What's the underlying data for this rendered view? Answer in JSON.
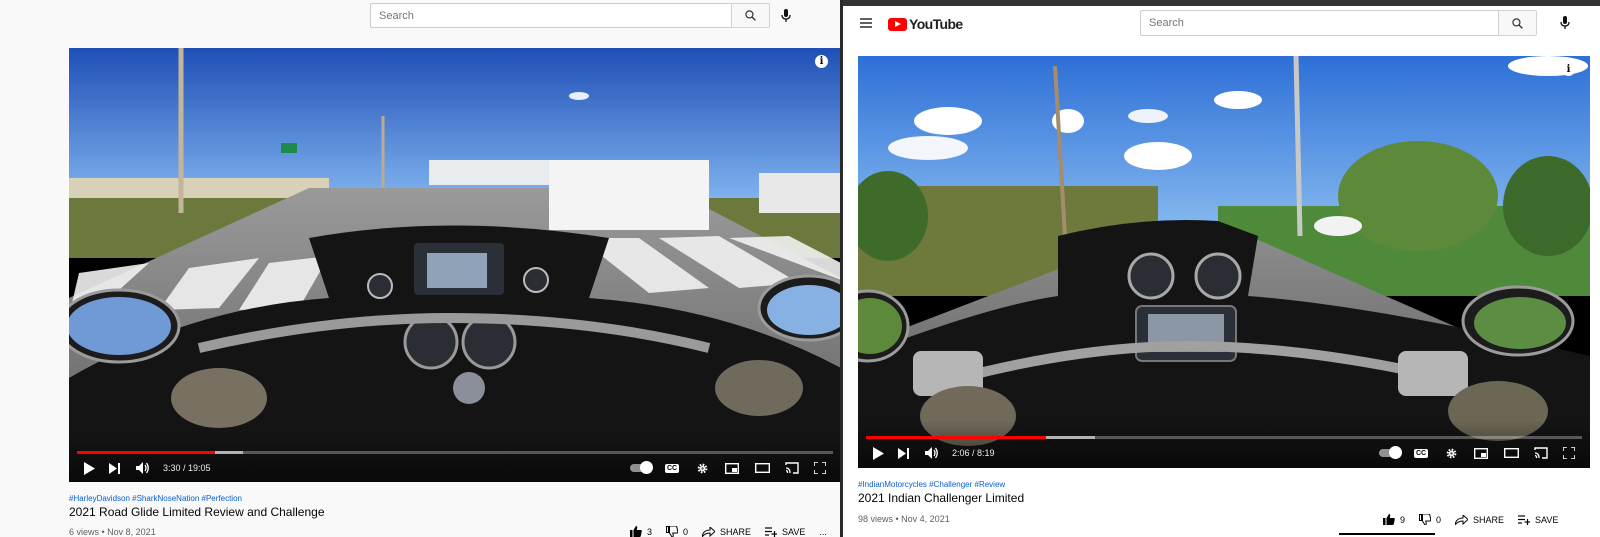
{
  "left": {
    "search": {
      "placeholder": "Search"
    },
    "video": {
      "time": "3:30 / 19:05",
      "progress_played": 0.183,
      "progress_buffered": 0.22
    },
    "hashtags": "#HarleyDavidson #SharkNoseNation #Perfection",
    "title": "2021 Road Glide Limited Review and Challenge",
    "stats": "6 views • Nov 8, 2021",
    "actions": {
      "likes": "3",
      "dislikes": "0",
      "share": "SHARE",
      "save": "SAVE",
      "more": "..."
    }
  },
  "right": {
    "logo_text": "YouTube",
    "search": {
      "placeholder": "Search"
    },
    "video": {
      "time": "2:06 / 8:19",
      "progress_played": 0.252,
      "progress_buffered": 0.32
    },
    "hashtags": "#IndianMotorcycles #Challenger #Review",
    "title": "2021 Indian Challenger Limited",
    "stats": "98 views • Nov 4, 2021",
    "actions": {
      "likes": "9",
      "dislikes": "0",
      "share": "SHARE",
      "save": "SAVE"
    }
  },
  "icons": {
    "search": "search-icon",
    "mic": "mic-icon",
    "menu": "hamburger-menu-icon",
    "info": "info-icon",
    "play": "play-icon",
    "next": "next-icon",
    "volume": "volume-icon",
    "cc": "captions-icon",
    "settings": "gear-icon",
    "miniplayer": "miniplayer-icon",
    "theater": "theater-mode-icon",
    "cast": "cast-icon",
    "fullscreen": "fullscreen-icon",
    "like": "thumbs-up-icon",
    "dislike": "thumbs-down-icon",
    "share": "share-icon",
    "save": "add-to-playlist-icon"
  },
  "colors": {
    "accent_red": "#ff0000",
    "link_blue": "#065fd4"
  }
}
